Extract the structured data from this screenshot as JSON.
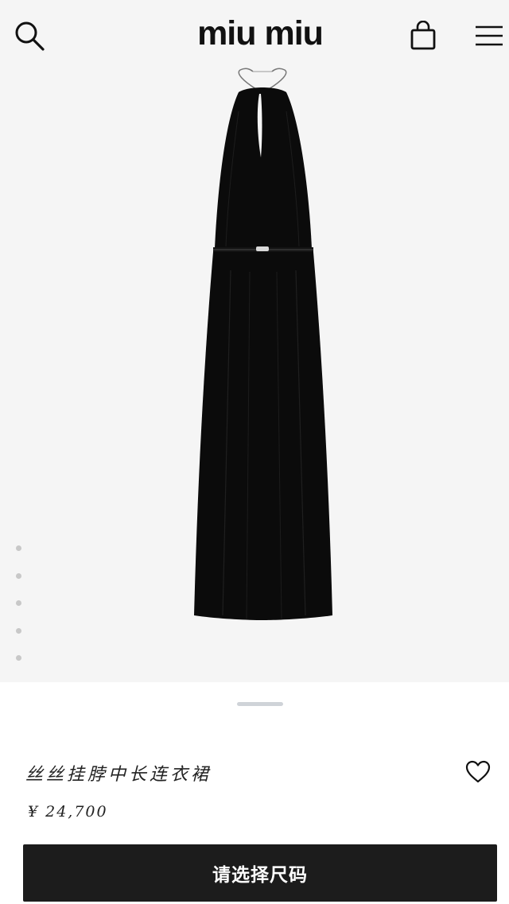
{
  "header": {
    "logo_text": "miu miu",
    "icons": [
      "search-icon",
      "shopping-bag-icon",
      "menu-icon"
    ]
  },
  "gallery": {
    "image": "black-halter-neck-midi-dress",
    "slide_count": 5
  },
  "product": {
    "name": "丝丝挂脖中长连衣裙",
    "price": "¥ 24,700",
    "favorite_icon": "heart-icon"
  },
  "actions": {
    "select_size_label": "请选择尺码"
  },
  "colors": {
    "hero_background": "#f5f5f5",
    "cta_background": "#1c1c1c",
    "dress": "#0b0b0b"
  }
}
